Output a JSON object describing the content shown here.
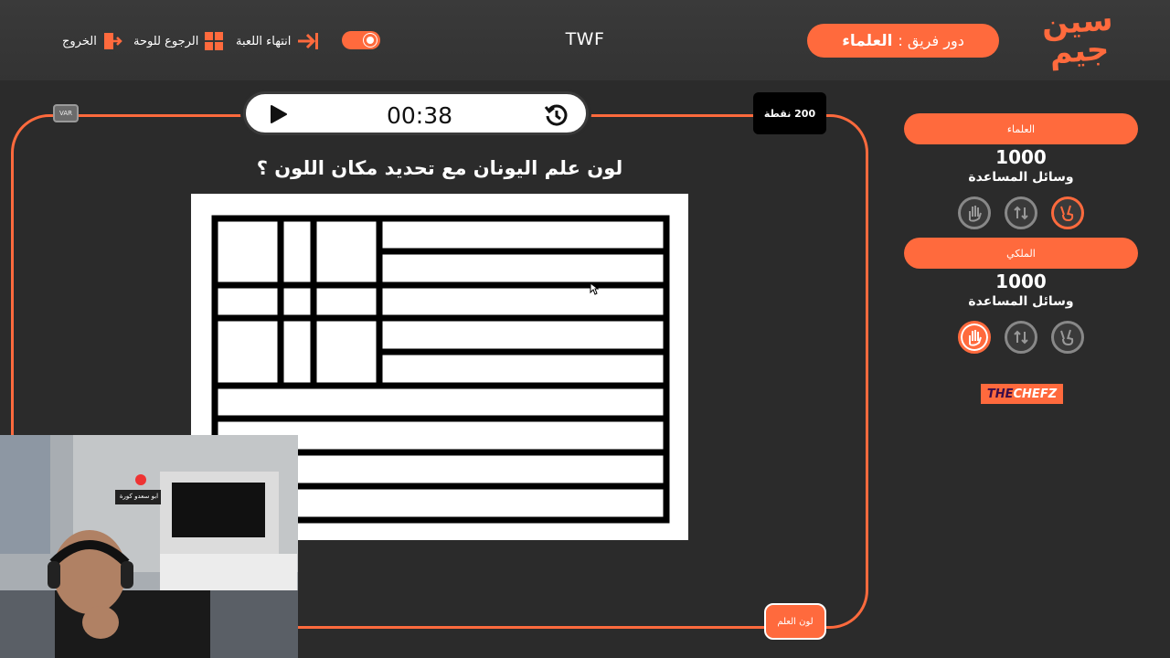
{
  "header": {
    "exit_label": "الخروج",
    "back_to_board_label": "الرجوع للوحة",
    "end_game_label": "انتهاء اللعبة",
    "title": "TWF",
    "turn_prefix": "دور فريق :",
    "turn_team": "العلماء",
    "brand": "سين جيم"
  },
  "game": {
    "timer": "00:38",
    "points": "200 نقطة",
    "question": "لون علم اليونان مع تحديد مكان اللون ؟",
    "category": "لون العلم",
    "var_label": "VAR"
  },
  "teams": [
    {
      "name": "العلماء",
      "score": "1000",
      "aids_label": "وسائل المساعدة"
    },
    {
      "name": "الملكي",
      "score": "1000",
      "aids_label": "وسائل المساعدة"
    }
  ],
  "sponsor": {
    "the": "THE",
    "chefz": "CHEFZ"
  },
  "webcam": {
    "sign": "ابو سعدو كورة"
  },
  "colors": {
    "accent": "#ff6a3d",
    "background": "#2b2b2b",
    "topbar": "#363636"
  },
  "icons": {
    "exit": "exit-door-icon",
    "board": "grid-icon",
    "end_game": "arrow-to-bar-icon",
    "play": "play-icon",
    "reset": "history-icon",
    "aid_hand": "raised-hand-icon",
    "aid_swap": "swap-arrows-icon",
    "aid_victory": "victory-hand-icon"
  }
}
